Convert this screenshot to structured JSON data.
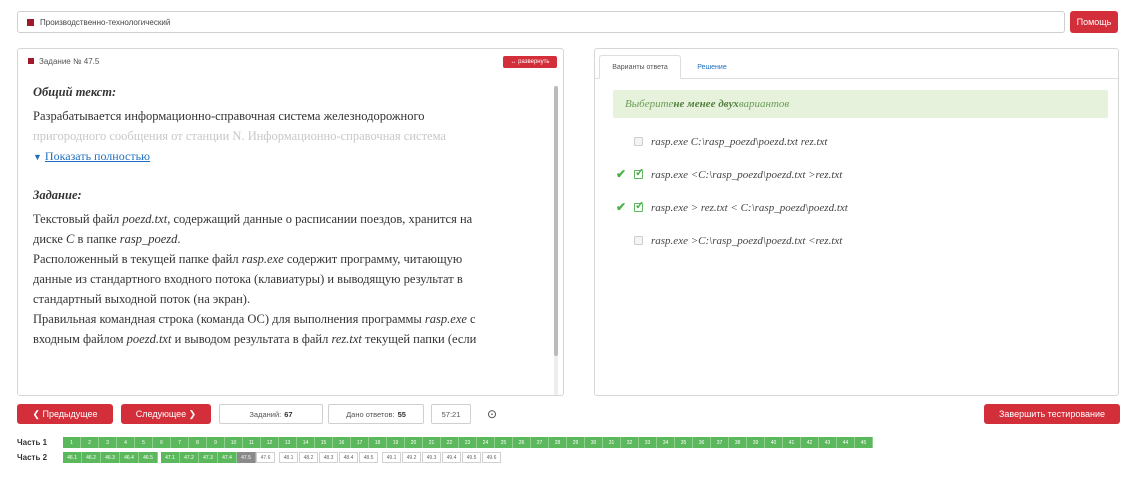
{
  "header": {
    "section": "Производственно-технологический",
    "help_label": "Помощь"
  },
  "task": {
    "title": "Задание № 47.5",
    "expand_label": "↔ развернуть",
    "general_heading": "Общий текст:",
    "general_line1": "Разрабатывается информационно-справочная система железнодорожного",
    "general_line2": "пригородного сообщения от станции N. Информационно-справочная система",
    "show_more": "Показать полностью",
    "task_heading": "Задание:",
    "l1a": "Текстовый файл ",
    "l1b": "poezd.txt",
    "l1c": ", содержащий данные о расписании поездов, хранится на",
    "l2a": "диске ",
    "l2b": "C",
    "l2c": " в папке ",
    "l2d": "rasp_poezd",
    "l2e": ".",
    "l3a": "Расположенный в текущей папке файл ",
    "l3b": "rasp.exe",
    "l3c": " содержит программу, читающую",
    "l4": "данные из стандартного входного потока (клавиатуры) и выводящую результат в",
    "l5": "стандартный выходной поток (на экран).",
    "l6a": "Правильная командная строка (команда ОС) для выполнения программы ",
    "l6b": "rasp.exe",
    "l6c": " с",
    "l7a": "входным файлом ",
    "l7b": "poezd.txt",
    "l7c": " и выводом результата в файл ",
    "l7d": "rez.txt",
    "l7e": " текущей папки (если"
  },
  "tabs": {
    "answers": "Варианты ответа",
    "solution": "Решение"
  },
  "instruction": {
    "a": "Выберите ",
    "b": "не менее двух",
    "c": " вариантов"
  },
  "options": [
    {
      "text": "rasp.exe  C:\\rasp_poezd\\poezd.txt rez.txt",
      "checked": false,
      "correct": false
    },
    {
      "text": "rasp.exe  <C:\\rasp_poezd\\poezd.txt  >rez.txt",
      "checked": true,
      "correct": true
    },
    {
      "text": "rasp.exe  > rez.txt  < C:\\rasp_poezd\\poezd.txt",
      "checked": true,
      "correct": true
    },
    {
      "text": "rasp.exe  >C:\\rasp_poezd\\poezd.txt  <rez.txt",
      "checked": false,
      "correct": false
    }
  ],
  "footer": {
    "prev_label": "❮ Предыдущее",
    "next_label": "Следующее ❯",
    "tasks_label": "Заданий:",
    "tasks_value": "67",
    "answers_label": "Дано ответов:",
    "answers_value": "55",
    "timer": "57:21",
    "finish_label": "Завершить тестирование"
  },
  "parts": [
    {
      "label": "Часть 1",
      "cells": [
        "1",
        "2",
        "3",
        "4",
        "5",
        "6",
        "7",
        "8",
        "9",
        "10",
        "11",
        "12",
        "13",
        "14",
        "15",
        "16",
        "17",
        "18",
        "19",
        "20",
        "21",
        "22",
        "23",
        "24",
        "25",
        "26",
        "27",
        "28",
        "29",
        "30",
        "31",
        "32",
        "33",
        "34",
        "35",
        "36",
        "37",
        "38",
        "39",
        "40",
        "41",
        "42",
        "43",
        "44",
        "45"
      ]
    },
    {
      "label": "Часть 2",
      "cells": [
        "46.1",
        "46.2",
        "46.3",
        "46.4",
        "46.5",
        "47.1",
        "47.2",
        "47.3",
        "47.4",
        "47.5",
        "47.6",
        "48.1",
        "48.2",
        "48.3",
        "48.4",
        "48.5",
        "49.1",
        "49.2",
        "49.3",
        "49.4",
        "49.5",
        "49.6"
      ]
    }
  ]
}
